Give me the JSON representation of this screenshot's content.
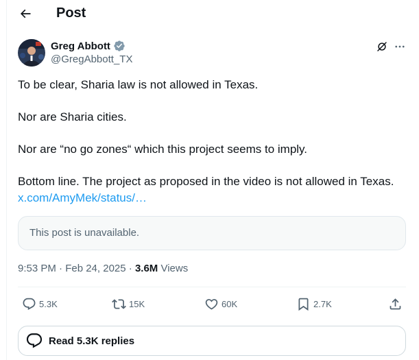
{
  "header": {
    "title": "Post"
  },
  "post": {
    "author": {
      "name": "Greg Abbott",
      "handle": "@GregAbbott_TX",
      "verified": true,
      "verified_color": "#829aab"
    },
    "paragraphs": [
      "To be clear, Sharia law is not allowed in Texas.",
      "Nor are Sharia cities.",
      "Nor are “no go zones“ which this project seems to imply.",
      "Bottom line. The project as proposed in the video is not allowed in Texas."
    ],
    "link_text": "x.com/AmyMek/status/…",
    "quoted_post": "This post is unavailable.",
    "timestamp": "9:53 PM · Feb 24, 2025",
    "separator": " · ",
    "views_count": "3.6M",
    "views_label": " Views",
    "metrics": {
      "replies": "5.3K",
      "reposts": "15K",
      "likes": "60K",
      "bookmarks": "2.7K"
    },
    "read_replies_label": "Read 5.3K replies"
  },
  "colors": {
    "link": "#1d9bf0",
    "secondary_text": "#536471",
    "primary_text": "#0f1419"
  },
  "icons": [
    "back-arrow-icon",
    "verified-badge-icon",
    "grok-icon",
    "more-icon",
    "reply-icon",
    "repost-icon",
    "like-icon",
    "bookmark-icon",
    "share-icon",
    "chat-bubble-icon"
  ]
}
